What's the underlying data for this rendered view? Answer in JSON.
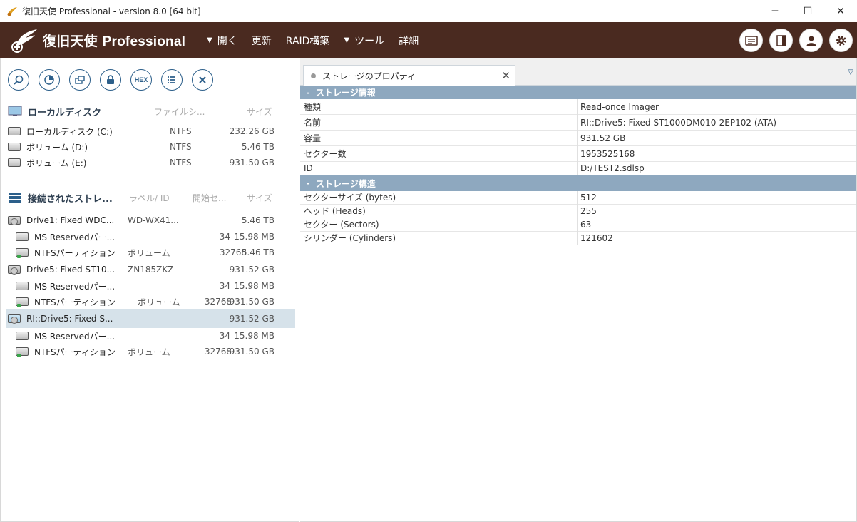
{
  "window": {
    "title": "復旧天使 Professional - version 8.0 [64 bit]"
  },
  "brand": {
    "name_jp": "復旧天使",
    "name_en": "Professional"
  },
  "menu": [
    {
      "label": "開く",
      "arrow": "▼"
    },
    {
      "label": "更新",
      "arrow": ""
    },
    {
      "label": "RAID構築",
      "arrow": ""
    },
    {
      "label": "ツール",
      "arrow": "▼"
    },
    {
      "label": "詳細",
      "arrow": ""
    }
  ],
  "toolbar": {
    "hex_label": "HEX"
  },
  "local": {
    "title": "ローカルディスク",
    "col_fs": "ファイルシ...",
    "col_size": "サイズ",
    "items": [
      {
        "name": "ローカルディスク (C:)",
        "fs": "NTFS",
        "size": "232.26 GB"
      },
      {
        "name": "ボリューム (D:)",
        "fs": "NTFS",
        "size": "5.46 TB"
      },
      {
        "name": "ボリューム (E:)",
        "fs": "NTFS",
        "size": "931.50 GB"
      }
    ]
  },
  "connected": {
    "title": "接続されたストレ...",
    "col_label": "ラベル/ ID",
    "col_start": "開始セ...",
    "col_size": "サイズ",
    "items": [
      {
        "name": "Drive1: Fixed WDC...",
        "label": "WD-WX41...",
        "start": "",
        "size": "5.46 TB"
      },
      {
        "name": "MS Reservedパー...",
        "label": "",
        "start": "34",
        "size": "15.98 MB"
      },
      {
        "name": "NTFSパーティション",
        "label": "ボリューム",
        "start": "32768",
        "size": "5.46 TB"
      },
      {
        "name": "Drive5: Fixed ST10...",
        "label": "ZN185ZKZ",
        "start": "",
        "size": "931.52 GB"
      },
      {
        "name": "MS Reservedパー...",
        "label": "",
        "start": "34",
        "size": "15.98 MB"
      },
      {
        "name": "NTFSパーティション",
        "label": "ボリューム",
        "start": "32768",
        "size": "931.50 GB"
      },
      {
        "name": "RI::Drive5: Fixed S...",
        "label": "",
        "start": "",
        "size": "931.52 GB"
      },
      {
        "name": "MS Reservedパー...",
        "label": "",
        "start": "34",
        "size": "15.98 MB"
      },
      {
        "name": "NTFSパーティション",
        "label": "ボリューム",
        "start": "32768",
        "size": "931.50 GB"
      }
    ]
  },
  "tab": {
    "label": "ストレージのプロパティ",
    "close": "✕"
  },
  "props": {
    "group1": {
      "title": "ストレージ情報",
      "sign": "-"
    },
    "info": [
      {
        "k": "種類",
        "v": "Read-once Imager"
      },
      {
        "k": "名前",
        "v": "RI::Drive5: Fixed ST1000DM010-2EP102 (ATA)"
      },
      {
        "k": "容量",
        "v": "931.52 GB"
      },
      {
        "k": "セクター数",
        "v": "1953525168"
      },
      {
        "k": "ID",
        "v": "D:/TEST2.sdlsp"
      }
    ],
    "group2": {
      "title": "ストレージ構造",
      "sign": "-"
    },
    "struct": [
      {
        "k": "セクターサイズ (bytes)",
        "v": "512"
      },
      {
        "k": "ヘッド (Heads)",
        "v": "255"
      },
      {
        "k": "セクター (Sectors)",
        "v": "63"
      },
      {
        "k": "シリンダー (Cylinders)",
        "v": "121602"
      }
    ]
  }
}
